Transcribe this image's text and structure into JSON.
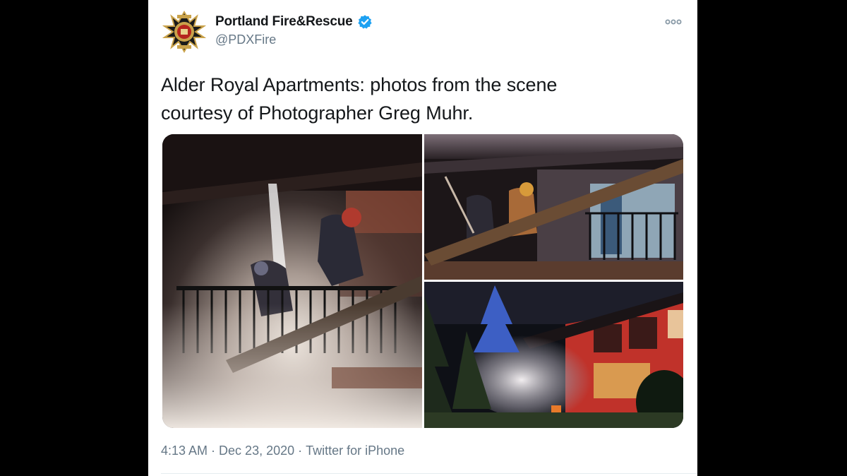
{
  "tweet": {
    "author": {
      "display_name": "Portland Fire&Rescue",
      "handle": "@PDXFire",
      "verified": true,
      "avatar_icon": "fire-department-maltese-cross-logo"
    },
    "text_line_1": "Alder Royal Apartments: photos from the scene",
    "text_line_2": "courtesy of Photographer Greg Muhr.",
    "media": [
      {
        "icon": "photo-firefighters-on-balcony"
      },
      {
        "icon": "photo-firefighters-on-ladder-porch"
      },
      {
        "icon": "photo-red-building-smoke-at-night"
      }
    ],
    "time": "4:13 AM",
    "date": "Dec 23, 2020",
    "source": "Twitter for iPhone",
    "separator": " · "
  },
  "colors": {
    "verified_blue": "#1da1f2",
    "text_primary": "#14171a",
    "text_secondary": "#657786",
    "background_outer": "#000000",
    "card_background": "#ffffff"
  }
}
